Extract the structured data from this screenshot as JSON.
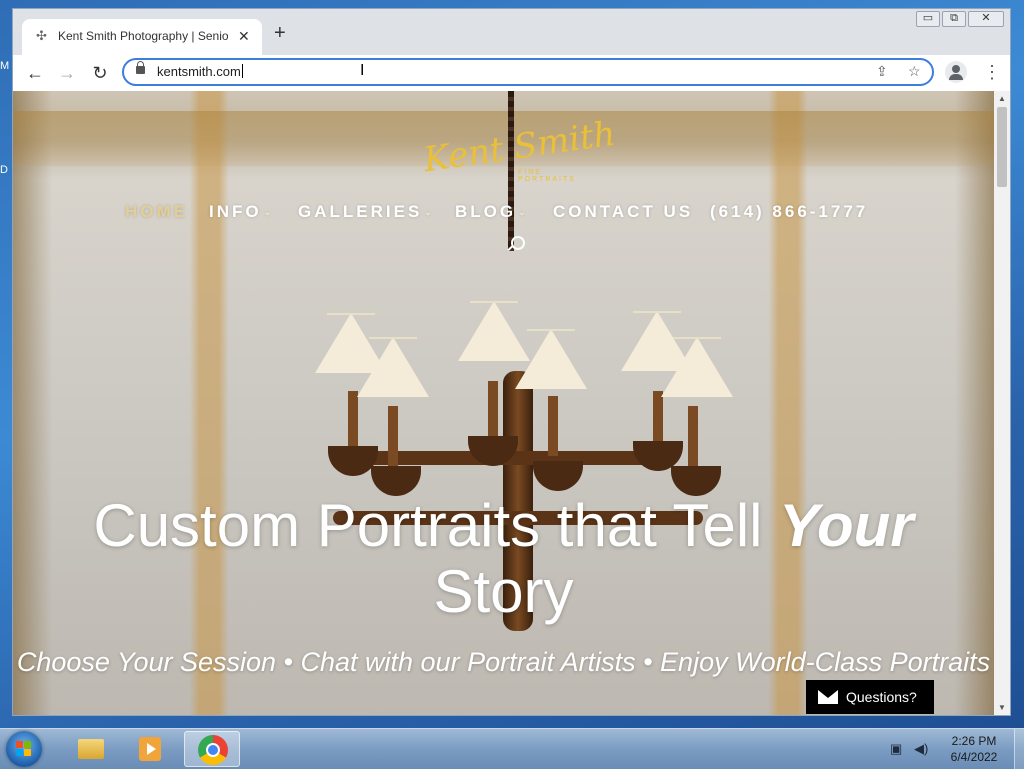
{
  "desktop": {
    "left_letters": [
      "M",
      "D"
    ]
  },
  "browser": {
    "tab_title": "Kent Smith Photography | Senior",
    "tab_close": "✕",
    "new_tab": "+",
    "url": "kentsmith.com",
    "nav": {
      "back": "←",
      "forward": "→",
      "reload": "↻"
    },
    "icons": [
      "share-icon",
      "bookmark-star-icon",
      "profile-icon",
      "menu-icon"
    ],
    "window_controls": {
      "minimize": "▭",
      "maximize": "⧉",
      "close": "✕"
    }
  },
  "site": {
    "logo_text": "Kent Smith",
    "logo_sub": "FINE PORTRAITS",
    "nav_items": [
      {
        "label": "HOME",
        "has_dropdown": false,
        "active": true
      },
      {
        "label": "INFO",
        "has_dropdown": true,
        "active": false
      },
      {
        "label": "GALLERIES",
        "has_dropdown": true,
        "active": false
      },
      {
        "label": "BLOG",
        "has_dropdown": true,
        "active": false
      },
      {
        "label": "CONTACT US",
        "has_dropdown": false,
        "active": false
      },
      {
        "label": "(614) 866-1777",
        "has_dropdown": false,
        "active": false
      }
    ],
    "dropdown_caret": "⌄",
    "hero": {
      "title_plain": "Custom Portraits that Tell ",
      "title_emphasis": "Your",
      "title_line2": "Story",
      "subtitle": "Choose Your Session • Chat with our Portrait Artists • Enjoy World-Class Portraits"
    },
    "questions_button": "Questions?"
  },
  "taskbar": {
    "time": "2:26 PM",
    "date": "6/4/2022",
    "apps": [
      "windows-explorer",
      "media-player",
      "google-chrome"
    ]
  },
  "colors": {
    "accent": "#3c7fd9",
    "logo_gold": "#e9c038",
    "nav_active": "#e3cf96"
  }
}
